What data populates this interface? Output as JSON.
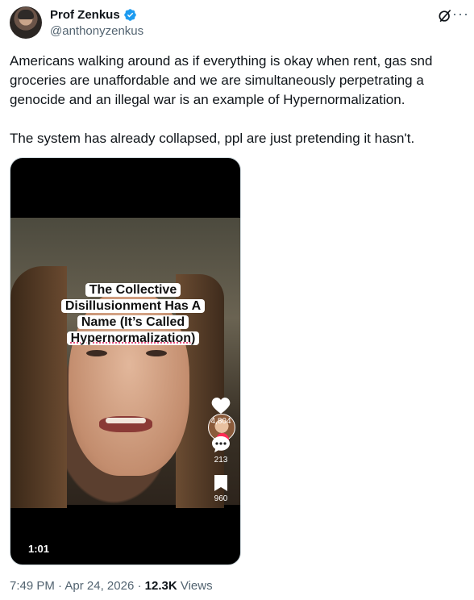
{
  "author": {
    "name": "Prof Zenkus",
    "handle": "@anthonyzenkus",
    "verified": true
  },
  "tweet": {
    "text": "Americans walking around as if everything is okay when rent, gas snd groceries are unaffordable and we are simultaneously perpetrating a genocide and an illegal war is an example of Hypernormalization.\n\nThe system has already collapsed, ppl are just pretending it hasn't."
  },
  "video": {
    "caption_lines": [
      "The Collective",
      "Disillusionment Has A",
      "Name (It’s Called",
      "Hypernormalization)"
    ],
    "likes": "4,804",
    "comments": "213",
    "saves": "960",
    "duration": "1:01"
  },
  "meta": {
    "time": "7:49 PM",
    "date": "Apr 24, 2026",
    "views_count": "12.3K",
    "views_label": "Views"
  },
  "colors": {
    "verified": "#1d9bf0",
    "muted_text": "#536471",
    "body_text": "#0f1419",
    "follow_plus": "#fe2c55"
  }
}
